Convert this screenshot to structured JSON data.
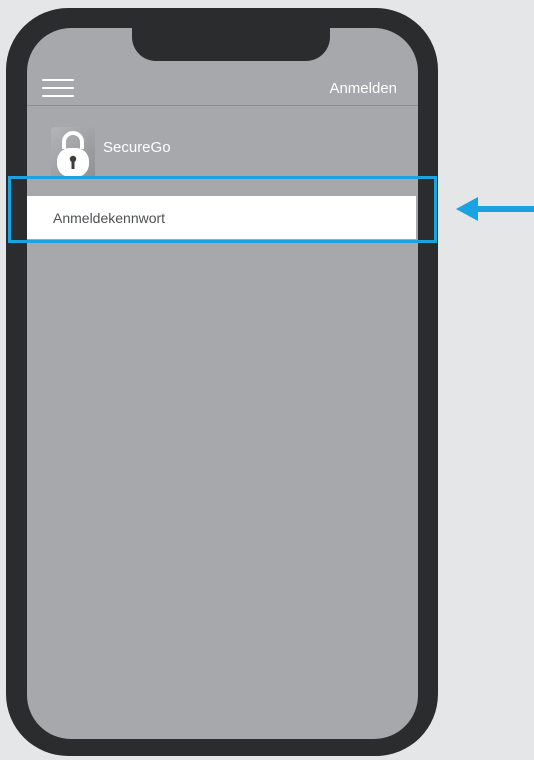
{
  "colors": {
    "background": "#e5e6e8",
    "phone_frame": "#2b2c2e",
    "screen": "#a7a8ab",
    "field_background": "#ffffff",
    "highlight": "#1aa3e2"
  },
  "header": {
    "menu_icon": "hamburger-menu-icon",
    "login_label": "Anmelden"
  },
  "app": {
    "icon": "padlock-icon",
    "name": "SecureGo"
  },
  "field": {
    "label": "Anmeldekennwort"
  },
  "annotation": {
    "highlight": "highlight-frame",
    "arrow": "left-arrow-icon"
  }
}
